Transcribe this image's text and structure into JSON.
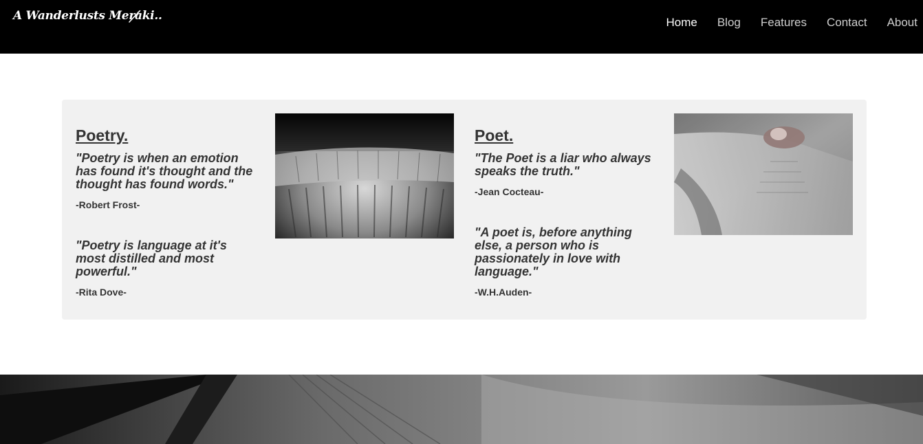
{
  "header": {
    "logo_text": "A Wanderlusts Meraki..",
    "nav": [
      {
        "label": "Home",
        "active": true
      },
      {
        "label": "Blog",
        "active": false
      },
      {
        "label": "Features",
        "active": false
      },
      {
        "label": "Contact",
        "active": false
      },
      {
        "label": "About",
        "active": false
      }
    ]
  },
  "poetry": {
    "heading": "Poetry.",
    "quotes": [
      {
        "text": "\"Poetry is when an emotion has found it's thought and the thought has found words.\"",
        "author": "-Robert Frost-"
      },
      {
        "text": "\"Poetry is language at it's most distilled and most powerful.\"",
        "author": "-Rita Dove-"
      }
    ]
  },
  "poet": {
    "heading": "Poet.",
    "quotes": [
      {
        "text": "\"The Poet is a liar who always speaks the truth.\"",
        "author": "-Jean Cocteau-"
      },
      {
        "text": "\"A poet is, before anything else, a person who is passionately in love with language.\"",
        "author": "-W.H.Auden-"
      }
    ]
  },
  "images": {
    "left": "book-pages-photo",
    "right": "hand-holding-book-photo",
    "banner": "open-book-banner-photo"
  },
  "colors": {
    "header_bg": "#000000",
    "card_bg": "#f1f1f1",
    "text": "#333333",
    "nav_active": "#ffffff",
    "nav": "#cfcfcf"
  }
}
